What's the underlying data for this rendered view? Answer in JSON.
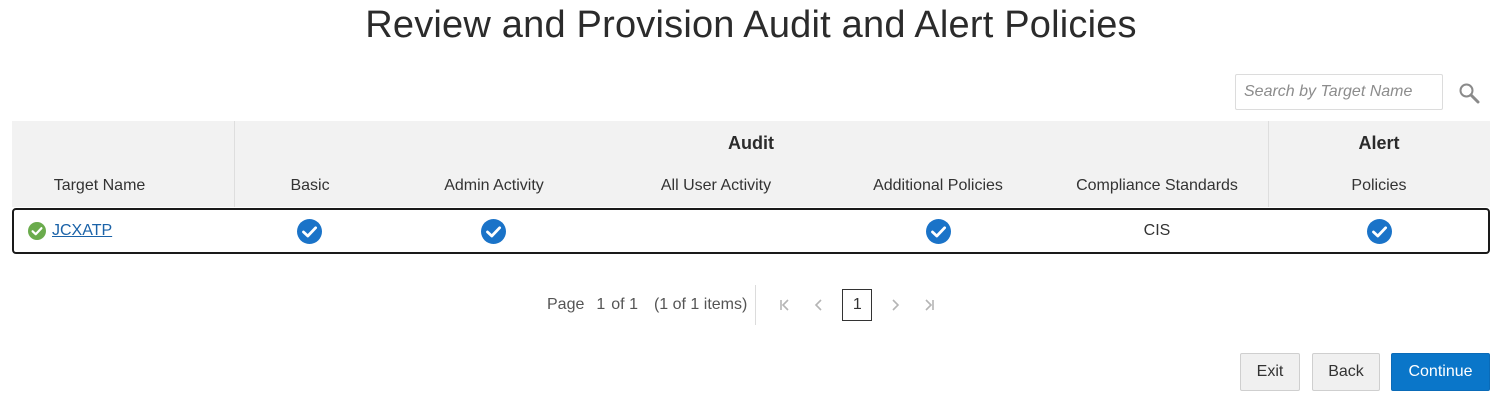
{
  "title": "Review and Provision Audit and Alert Policies",
  "search": {
    "placeholder": "Search by Target Name",
    "value": ""
  },
  "table": {
    "group_headers": {
      "audit": "Audit",
      "alert": "Alert"
    },
    "columns": {
      "target_name": "Target Name",
      "basic": "Basic",
      "admin_activity": "Admin Activity",
      "all_user_activity": "All User Activity",
      "additional_policies": "Additional Policies",
      "compliance_standards": "Compliance Standards",
      "alert_policies": "Policies"
    },
    "rows": [
      {
        "target_name": "JCXATP",
        "status": "success",
        "basic": true,
        "admin_activity": true,
        "all_user_activity": false,
        "additional_policies": true,
        "compliance_standards": "CIS",
        "alert_policies": true
      }
    ]
  },
  "pagination": {
    "page_label": "Page",
    "current_page": "1",
    "of_label": "of 1",
    "items_label": "(1 of 1 items)",
    "page_button": "1"
  },
  "buttons": {
    "exit": "Exit",
    "back": "Back",
    "continue": "Continue"
  },
  "colors": {
    "primary": "#0a76c9",
    "check": "#1a73c8",
    "success": "#6aab4c",
    "link": "#1a62a8",
    "header_bg": "#f2f2f2"
  },
  "icons": {
    "search": "search-icon",
    "check": "check-circle-icon",
    "status": "success-status-icon",
    "first": "first-page-icon",
    "prev": "previous-page-icon",
    "next": "next-page-icon",
    "last": "last-page-icon"
  }
}
